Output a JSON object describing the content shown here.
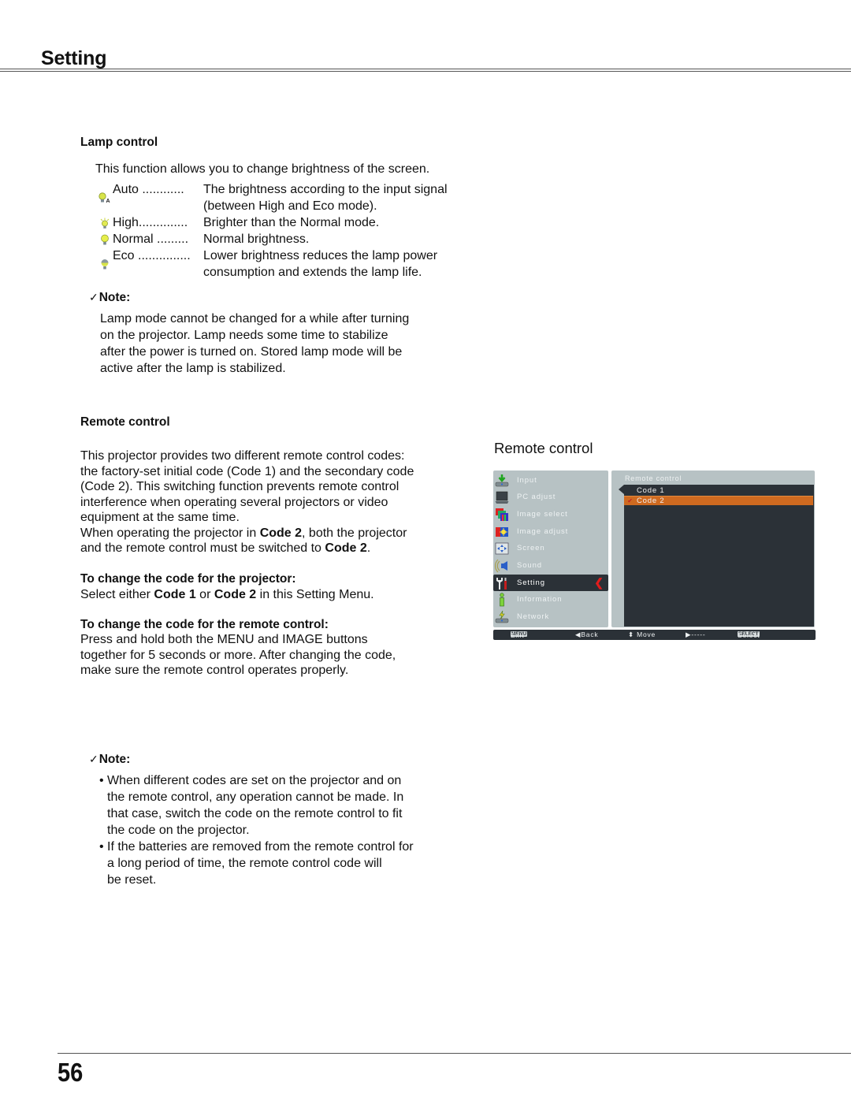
{
  "header": {
    "title": "Setting"
  },
  "lamp_control": {
    "heading": "Lamp control",
    "intro": "This function allows you to change brightness of the screen.",
    "modes": [
      {
        "icon": "lamp-auto-icon",
        "term": "Auto ............",
        "desc1": "The brightness according to the input signal",
        "desc2": "(between High and Eco mode)."
      },
      {
        "icon": "lamp-high-icon",
        "term": "High..............",
        "desc1": "Brighter than the Normal mode.",
        "desc2": ""
      },
      {
        "icon": "lamp-normal-icon",
        "term": "Normal .........",
        "desc1": "Normal brightness.",
        "desc2": ""
      },
      {
        "icon": "lamp-eco-icon",
        "term": "Eco ...............",
        "desc1": "Lower brightness reduces the lamp power",
        "desc2": "consumption and extends the lamp life."
      }
    ],
    "note_check": "✓",
    "note_label": "Note:",
    "note_lines": [
      "Lamp mode cannot be changed for a while after turning",
      "on the projector. Lamp needs some time to stabilize",
      "after the power is turned on. Stored lamp mode will be",
      "active after the lamp is stabilized."
    ]
  },
  "remote_control": {
    "heading": "Remote control",
    "intro_lines": [
      "This projector provides two different remote control codes:",
      "the factory-set initial code (Code 1) and the secondary code",
      "(Code 2). This switching function prevents remote control",
      "interference when operating several projectors or video",
      "equipment at the same time."
    ],
    "line6": {
      "a": "When operating the projector in ",
      "b": "Code 2",
      "c": ", both the projector"
    },
    "line7": {
      "a": "and the remote control must be switched to ",
      "b": "Code 2",
      "c": "."
    },
    "projector_heading": "To change the code for the projector:",
    "projector_text": {
      "a": "Select either ",
      "b": "Code 1",
      "c": " or ",
      "d": "Code 2",
      "e": " in this Setting Menu."
    },
    "remote_heading": "To change the code for the remote control:",
    "remote_lines": [
      "Press and hold both the MENU and IMAGE buttons",
      "together for 5 seconds or more. After changing the code,",
      "make sure the  remote control operates properly."
    ],
    "note_check": "✓",
    "note_label": "Note:",
    "bullet_char": "•",
    "bullets": [
      [
        "When different codes are set on the projector and on",
        "the remote control, any operation cannot be made. In",
        "that case, switch the code on the remote control to fit",
        "the code on the projector."
      ],
      [
        "If the batteries are removed from the remote control for",
        "a long period of time, the remote control code will",
        "be reset."
      ]
    ]
  },
  "osd": {
    "section_title": "Remote control",
    "menu_items": [
      {
        "label": "Input",
        "icon": "input-icon"
      },
      {
        "label": "PC adjust",
        "icon": "pc-adjust-icon"
      },
      {
        "label": "Image select",
        "icon": "image-select-icon"
      },
      {
        "label": "Image adjust",
        "icon": "image-adjust-icon"
      },
      {
        "label": "Screen",
        "icon": "screen-icon"
      },
      {
        "label": "Sound",
        "icon": "sound-icon"
      },
      {
        "label": "Setting",
        "icon": "setting-icon",
        "active": true
      },
      {
        "label": "Information",
        "icon": "information-icon"
      },
      {
        "label": "Network",
        "icon": "network-icon"
      }
    ],
    "active_arrow": "❮",
    "submenu_title": "Remote control",
    "options": [
      {
        "label": "Code 1",
        "selected": false
      },
      {
        "label": "Code 2",
        "selected": true
      }
    ],
    "check_mark": "✔",
    "footer": {
      "exit_key": "MENU",
      "exit": "Exit",
      "back": "◀Back",
      "move": "⬍ Move",
      "next": "▶-----",
      "select_key": "SELECT",
      "select": "Select"
    },
    "colors": {
      "panel": "#b7c2c4",
      "dark": "#2b3137",
      "highlight": "#cf6a20",
      "arrow": "#e21c1c"
    }
  },
  "footer": {
    "page_number": "56"
  }
}
